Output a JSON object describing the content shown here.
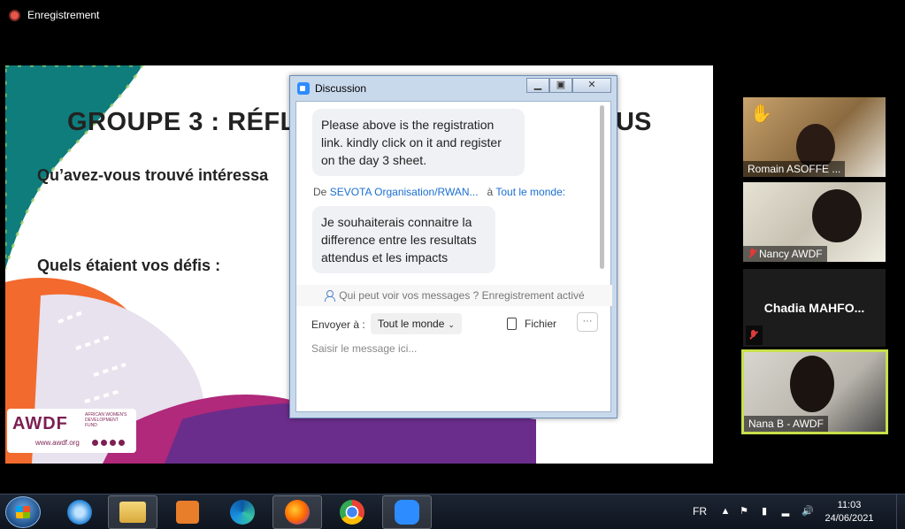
{
  "recording": {
    "label": "Enregistrement"
  },
  "slide": {
    "title": "GROUPE 3 : RÉFL",
    "title_tail": "US",
    "question_1": "Qu’avez-vous trouvé intéressa",
    "question_2": "Quels étaient vos défis :",
    "logo_text": "AWDF",
    "logo_subtitle": "AFRICAN WOMEN'S DEVELOPMENT FUND",
    "logo_url": "www.awdf.org",
    "colors": {
      "teal": "#0f7d7c",
      "orange": "#f26a2e",
      "purple": "#6b2d8c",
      "magenta": "#b0297a"
    }
  },
  "chat": {
    "title": "Discussion",
    "messages": [
      {
        "text": "Please above is the registration link. kindly click on it and register on the day 3 sheet."
      },
      {
        "from_prefix": "De",
        "from": "SEVOTA Organisation/RWAN...",
        "to_prefix": "à",
        "to": "Tout le monde:",
        "text": "Je souhaiterais connaitre la difference entre les resultats attendus et les impacts"
      }
    ],
    "privacy_note": "Qui peut voir vos messages ? Enregistrement activé",
    "send_to_label": "Envoyer à :",
    "send_to_value": "Tout le monde",
    "file_label": "Fichier",
    "more_label": "···",
    "input_placeholder": "Saisir le message ici..."
  },
  "participants": [
    {
      "name": "Romain ASOFFE ...",
      "hand_raised": true,
      "muted": false
    },
    {
      "name": "Nancy AWDF",
      "hand_raised": false,
      "muted": true
    },
    {
      "name": "Chadia  MAHFO...",
      "hand_raised": false,
      "muted": true,
      "video_off": true
    },
    {
      "name": "Nana B - AWDF",
      "hand_raised": false,
      "muted": false,
      "active_speaker": true
    }
  ],
  "taskbar": {
    "apps": [
      "start-menu",
      "internet-explorer",
      "file-explorer",
      "media-player",
      "edge",
      "firefox",
      "chrome",
      "zoom"
    ],
    "language": "FR",
    "time": "11:03",
    "date": "24/06/2021"
  }
}
